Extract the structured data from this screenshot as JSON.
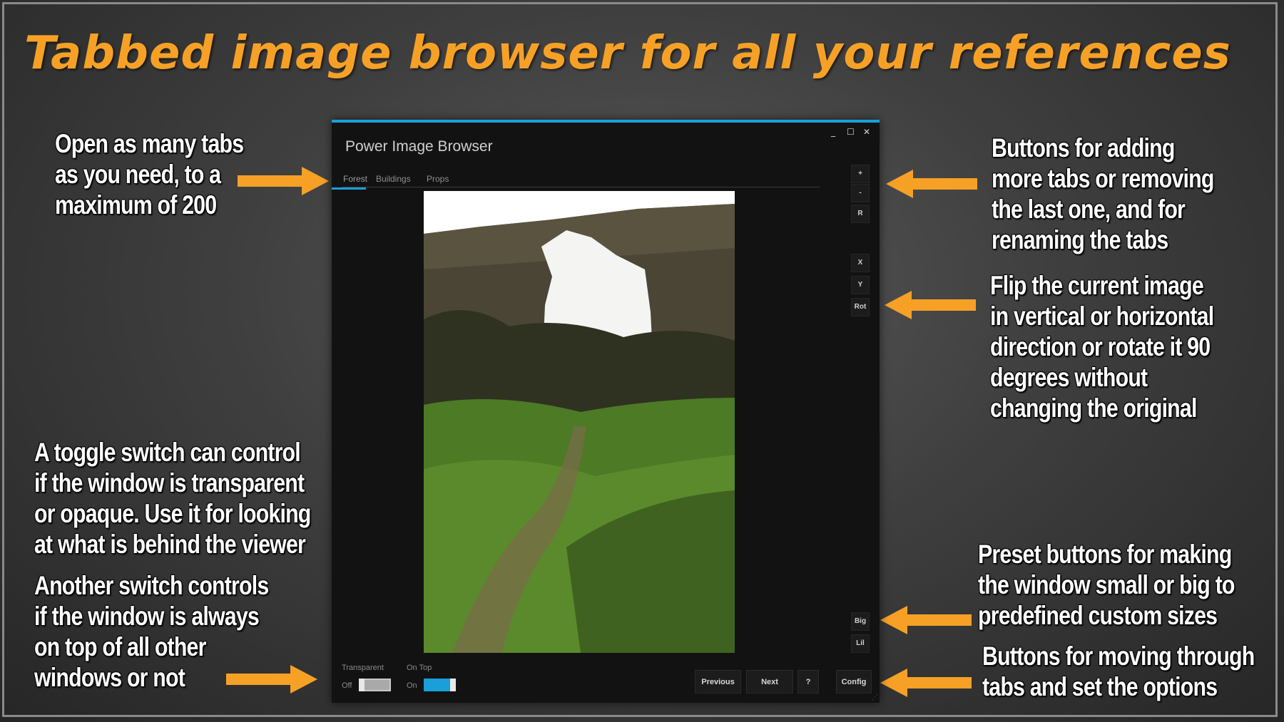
{
  "headline": "Tabbed image browser for all your references",
  "notes": {
    "tabs": [
      "Open as many tabs",
      "as you need, to a",
      "maximum of 200"
    ],
    "tab_buttons": [
      "Buttons for adding",
      "more tabs or removing",
      "the last one, and for",
      "renaming the tabs"
    ],
    "flip": [
      "Flip the current image",
      "in vertical or horizontal",
      "direction or rotate it 90",
      "degrees without",
      "changing the original"
    ],
    "transparent": [
      "A toggle switch can control",
      "if the window is transparent",
      "or opaque. Use it for looking",
      "at what is behind the viewer"
    ],
    "ontop": [
      "Another switch controls",
      "if the window is always",
      "on top of all other",
      "windows or not"
    ],
    "presets": [
      "Preset buttons for making",
      "the window small or big to",
      "predefined custom sizes"
    ],
    "nav": [
      "Buttons for moving through",
      "tabs and set the options"
    ]
  },
  "colors": {
    "accent": "#1a9fd9",
    "highlight": "#f6a126"
  },
  "window": {
    "title": "Power Image Browser",
    "controls": {
      "minimize": "_",
      "maximize": "☐",
      "close": "✕"
    },
    "tabs": [
      {
        "label": "Forest",
        "active": true
      },
      {
        "label": "Buildings",
        "active": false
      },
      {
        "label": "Props",
        "active": false
      }
    ],
    "side_buttons": {
      "add": "+",
      "remove": "-",
      "rename": "R",
      "flip_x": "X",
      "flip_y": "Y",
      "rotate": "Rot",
      "big": "Big",
      "lil": "Lil"
    },
    "toggles": {
      "transparent": {
        "label": "Transparent",
        "state": "Off",
        "on": false
      },
      "ontop": {
        "label": "On Top",
        "state": "On",
        "on": true
      }
    },
    "buttons": {
      "previous": "Previous",
      "next": "Next",
      "help": "?",
      "config": "Config"
    }
  }
}
